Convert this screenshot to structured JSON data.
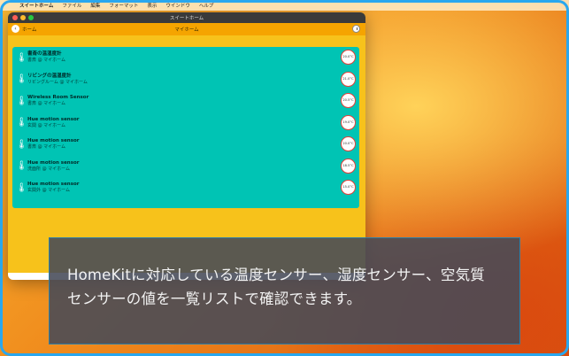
{
  "menubar": {
    "app_name": "スイートホーム",
    "items": [
      "ファイル",
      "編集",
      "フォーマット",
      "表示",
      "ウインドウ",
      "ヘルプ"
    ]
  },
  "window": {
    "title": "スイートホーム",
    "nav_title": "マイホーム",
    "back_label": "ホーム"
  },
  "sensors": [
    {
      "name": "書斎の温湿度計",
      "location": "書斎 @ マイホーム",
      "reading": "20.0°C"
    },
    {
      "name": "リビングの温湿度計",
      "location": "リビングルーム @ マイホーム",
      "reading": "21.0°C"
    },
    {
      "name": "Wireless Room Sensor",
      "location": "書斎 @ マイホーム",
      "reading": "20.5°C"
    },
    {
      "name": "Hue motion sensor",
      "location": "玄関 @ マイホーム",
      "reading": "19.0°C"
    },
    {
      "name": "Hue motion sensor",
      "location": "書斎 @ マイホーム",
      "reading": "20.0°C"
    },
    {
      "name": "Hue motion sensor",
      "location": "洗面所 @ マイホーム",
      "reading": "18.5°C"
    },
    {
      "name": "Hue motion sensor",
      "location": "玄関外 @ マイホーム",
      "reading": "15.0°C"
    }
  ],
  "caption": {
    "line1": "HomeKitに対応している温度センサー、湿度センサー、空気質",
    "line2": "センサーの値を一覧リストで確認できます。"
  }
}
